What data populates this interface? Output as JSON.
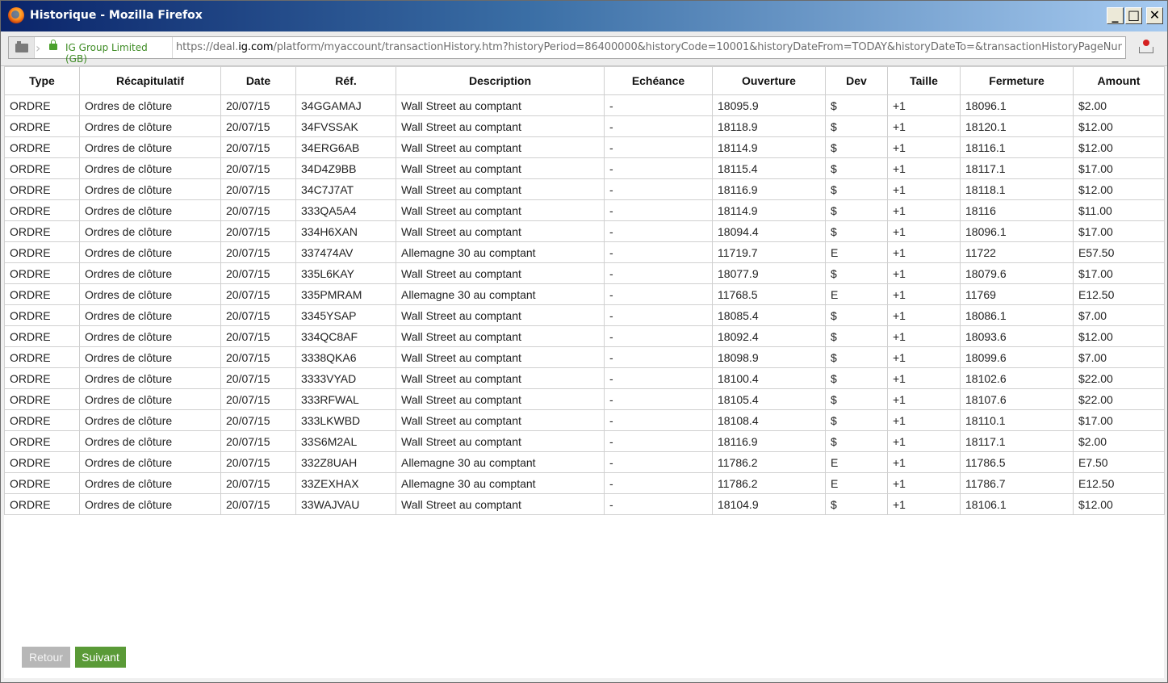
{
  "window": {
    "title": "Historique - Mozilla Firefox"
  },
  "navbar": {
    "identity": "IG Group Limited (GB)",
    "url_prefix": "https://deal.",
    "url_domain": "ig.com",
    "url_rest": "/platform/myaccount/transactionHistory.htm?historyPeriod=86400000&historyCode=10001&historyDateFrom=TODAY&historyDateTo=&transactionHistoryPageNumber="
  },
  "table": {
    "headers": [
      "Type",
      "Récapitulatif",
      "Date",
      "Réf.",
      "Description",
      "Echéance",
      "Ouverture",
      "Dev",
      "Taille",
      "Fermeture",
      "Amount"
    ],
    "rows": [
      [
        "ORDRE",
        "Ordres de clôture",
        "20/07/15",
        "34GGAMAJ",
        "Wall Street au comptant",
        "-",
        "18095.9",
        "$",
        "+1",
        "18096.1",
        "$2.00"
      ],
      [
        "ORDRE",
        "Ordres de clôture",
        "20/07/15",
        "34FVSSAK",
        "Wall Street au comptant",
        "-",
        "18118.9",
        "$",
        "+1",
        "18120.1",
        "$12.00"
      ],
      [
        "ORDRE",
        "Ordres de clôture",
        "20/07/15",
        "34ERG6AB",
        "Wall Street au comptant",
        "-",
        "18114.9",
        "$",
        "+1",
        "18116.1",
        "$12.00"
      ],
      [
        "ORDRE",
        "Ordres de clôture",
        "20/07/15",
        "34D4Z9BB",
        "Wall Street au comptant",
        "-",
        "18115.4",
        "$",
        "+1",
        "18117.1",
        "$17.00"
      ],
      [
        "ORDRE",
        "Ordres de clôture",
        "20/07/15",
        "34C7J7AT",
        "Wall Street au comptant",
        "-",
        "18116.9",
        "$",
        "+1",
        "18118.1",
        "$12.00"
      ],
      [
        "ORDRE",
        "Ordres de clôture",
        "20/07/15",
        "333QA5A4",
        "Wall Street au comptant",
        "-",
        "18114.9",
        "$",
        "+1",
        "18116",
        "$11.00"
      ],
      [
        "ORDRE",
        "Ordres de clôture",
        "20/07/15",
        "334H6XAN",
        "Wall Street au comptant",
        "-",
        "18094.4",
        "$",
        "+1",
        "18096.1",
        "$17.00"
      ],
      [
        "ORDRE",
        "Ordres de clôture",
        "20/07/15",
        "337474AV",
        "Allemagne 30 au comptant",
        "-",
        "11719.7",
        "E",
        "+1",
        "11722",
        "E57.50"
      ],
      [
        "ORDRE",
        "Ordres de clôture",
        "20/07/15",
        "335L6KAY",
        "Wall Street au comptant",
        "-",
        "18077.9",
        "$",
        "+1",
        "18079.6",
        "$17.00"
      ],
      [
        "ORDRE",
        "Ordres de clôture",
        "20/07/15",
        "335PMRAM",
        "Allemagne 30 au comptant",
        "-",
        "11768.5",
        "E",
        "+1",
        "11769",
        "E12.50"
      ],
      [
        "ORDRE",
        "Ordres de clôture",
        "20/07/15",
        "3345YSAP",
        "Wall Street au comptant",
        "-",
        "18085.4",
        "$",
        "+1",
        "18086.1",
        "$7.00"
      ],
      [
        "ORDRE",
        "Ordres de clôture",
        "20/07/15",
        "334QC8AF",
        "Wall Street au comptant",
        "-",
        "18092.4",
        "$",
        "+1",
        "18093.6",
        "$12.00"
      ],
      [
        "ORDRE",
        "Ordres de clôture",
        "20/07/15",
        "3338QKA6",
        "Wall Street au comptant",
        "-",
        "18098.9",
        "$",
        "+1",
        "18099.6",
        "$7.00"
      ],
      [
        "ORDRE",
        "Ordres de clôture",
        "20/07/15",
        "3333VYAD",
        "Wall Street au comptant",
        "-",
        "18100.4",
        "$",
        "+1",
        "18102.6",
        "$22.00"
      ],
      [
        "ORDRE",
        "Ordres de clôture",
        "20/07/15",
        "333RFWAL",
        "Wall Street au comptant",
        "-",
        "18105.4",
        "$",
        "+1",
        "18107.6",
        "$22.00"
      ],
      [
        "ORDRE",
        "Ordres de clôture",
        "20/07/15",
        "333LKWBD",
        "Wall Street au comptant",
        "-",
        "18108.4",
        "$",
        "+1",
        "18110.1",
        "$17.00"
      ],
      [
        "ORDRE",
        "Ordres de clôture",
        "20/07/15",
        "33S6M2AL",
        "Wall Street au comptant",
        "-",
        "18116.9",
        "$",
        "+1",
        "18117.1",
        "$2.00"
      ],
      [
        "ORDRE",
        "Ordres de clôture",
        "20/07/15",
        "332Z8UAH",
        "Allemagne 30 au comptant",
        "-",
        "11786.2",
        "E",
        "+1",
        "11786.5",
        "E7.50"
      ],
      [
        "ORDRE",
        "Ordres de clôture",
        "20/07/15",
        "33ZEXHAX",
        "Allemagne 30 au comptant",
        "-",
        "11786.2",
        "E",
        "+1",
        "11786.7",
        "E12.50"
      ],
      [
        "ORDRE",
        "Ordres de clôture",
        "20/07/15",
        "33WAJVAU",
        "Wall Street au comptant",
        "-",
        "18104.9",
        "$",
        "+1",
        "18106.1",
        "$12.00"
      ]
    ]
  },
  "pagination": {
    "prev_label": "Retour",
    "next_label": "Suivant"
  }
}
